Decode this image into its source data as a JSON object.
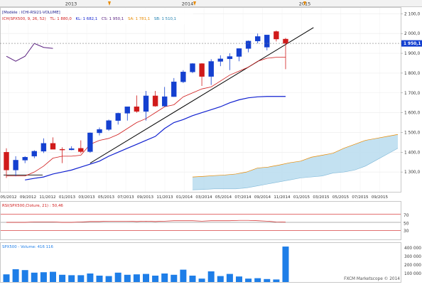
{
  "top_years": [
    "2013",
    "2014",
    "2015"
  ],
  "header": {
    "model_line": "[Modèle : ICHI-RSI21-VOLUME]",
    "ichimoku_line": "ICH(SPX500, 9, 26, 52) · TL: 1 880,0 · KL: 1 682,1 · CS: 1 950,1 · SA: 1 781,1 · SB: 1 510,1",
    "tl": "TL: 1 880,0",
    "kl": "KL: 1 682,1",
    "cs": "CS: 1 950,1",
    "sa": "SA: 1 781,1",
    "sb": "SB: 1 510,1",
    "ich_prefix": "ICH(SPX500, 9, 26, 52)"
  },
  "price_axis": {
    "ticks": [
      "2 100,0",
      "2 000,0",
      "1 900,0",
      "1 800,0",
      "1 700,0",
      "1 600,0",
      "1 500,0",
      "1 400,0",
      "1 300,0"
    ],
    "current_price": "1 950,1"
  },
  "time_axis": {
    "labels": [
      "05/2012",
      "09/2012",
      "11/2012",
      "01/2013",
      "03/2013",
      "05/2013",
      "07/2013",
      "09/2013",
      "11/2013",
      "01/2014",
      "03/2014",
      "05/2014",
      "07/2014",
      "09/2014",
      "11/2014",
      "01/2015",
      "03/2015",
      "05/2015",
      "07/2015",
      "09/2015"
    ]
  },
  "rsi_panel": {
    "label": "RSI(SPX500,Cloture, 21) : 50,46",
    "levels": [
      "70",
      "50",
      "30"
    ]
  },
  "volume_panel": {
    "label": "SPX500 - Volume: 416 116",
    "ticks": [
      "400 000",
      "300 000",
      "200 000",
      "100 000"
    ]
  },
  "copyright": "FXCM Marketscope © 2014",
  "colors": {
    "bull": "#1440d0",
    "bear": "#d01a1a",
    "tenkan": "#d01a1a",
    "kijun": "#1020d0",
    "chikou": "#5a2080",
    "cloud": "#b8dcef",
    "trendline": "#000000",
    "volume": "#1e7ee8",
    "orange": "#e88a00"
  },
  "chart_data": [
    {
      "type": "candlestick",
      "title": "",
      "candles": [
        {
          "o": 1400,
          "h": 1420,
          "l": 1270,
          "c": 1310
        },
        {
          "o": 1310,
          "h": 1380,
          "l": 1280,
          "c": 1360
        },
        {
          "o": 1360,
          "h": 1380,
          "l": 1345,
          "c": 1375
        },
        {
          "o": 1380,
          "h": 1410,
          "l": 1370,
          "c": 1405
        },
        {
          "o": 1405,
          "h": 1470,
          "l": 1396,
          "c": 1445
        },
        {
          "o": 1445,
          "h": 1475,
          "l": 1425,
          "c": 1415
        },
        {
          "o": 1415,
          "h": 1425,
          "l": 1345,
          "c": 1412
        },
        {
          "o": 1412,
          "h": 1430,
          "l": 1410,
          "c": 1418
        },
        {
          "o": 1420,
          "h": 1460,
          "l": 1395,
          "c": 1403
        },
        {
          "o": 1403,
          "h": 1500,
          "l": 1397,
          "c": 1498
        },
        {
          "o": 1498,
          "h": 1525,
          "l": 1485,
          "c": 1515
        },
        {
          "o": 1515,
          "h": 1565,
          "l": 1508,
          "c": 1560
        },
        {
          "o": 1560,
          "h": 1600,
          "l": 1540,
          "c": 1597
        },
        {
          "o": 1597,
          "h": 1630,
          "l": 1560,
          "c": 1630
        },
        {
          "o": 1630,
          "h": 1687,
          "l": 1600,
          "c": 1606
        },
        {
          "o": 1606,
          "h": 1710,
          "l": 1560,
          "c": 1685
        },
        {
          "o": 1685,
          "h": 1710,
          "l": 1630,
          "c": 1633
        },
        {
          "o": 1633,
          "h": 1730,
          "l": 1630,
          "c": 1681
        },
        {
          "o": 1681,
          "h": 1775,
          "l": 1680,
          "c": 1756
        },
        {
          "o": 1756,
          "h": 1815,
          "l": 1750,
          "c": 1806
        },
        {
          "o": 1806,
          "h": 1850,
          "l": 1800,
          "c": 1848
        },
        {
          "o": 1848,
          "h": 1850,
          "l": 1735,
          "c": 1783
        },
        {
          "o": 1783,
          "h": 1870,
          "l": 1740,
          "c": 1859
        },
        {
          "o": 1859,
          "h": 1890,
          "l": 1835,
          "c": 1872
        },
        {
          "o": 1872,
          "h": 1900,
          "l": 1815,
          "c": 1884
        },
        {
          "o": 1884,
          "h": 1925,
          "l": 1860,
          "c": 1924
        },
        {
          "o": 1924,
          "h": 1965,
          "l": 1905,
          "c": 1962
        },
        {
          "o": 1962,
          "h": 2000,
          "l": 1950,
          "c": 1985
        },
        {
          "o": 1931,
          "h": 1991,
          "l": 1915,
          "c": 1993
        },
        {
          "o": 2010,
          "h": 2015,
          "l": 1960,
          "c": 1972
        },
        {
          "o": 1972,
          "h": 1978,
          "l": 1820,
          "c": 1950
        }
      ],
      "tenkan": [
        1280,
        1280,
        1280,
        1300,
        1330,
        1370,
        1380,
        1380,
        1385,
        1440,
        1460,
        1470,
        1490,
        1520,
        1550,
        1570,
        1600,
        1630,
        1640,
        1680,
        1700,
        1720,
        1730,
        1760,
        1790,
        1810,
        1830,
        1860,
        1875,
        1880,
        1880
      ],
      "kijun_start_index": 2,
      "kijun": [
        1260,
        1268,
        1275,
        1290,
        1300,
        1310,
        1325,
        1340,
        1355,
        1380,
        1400,
        1420,
        1440,
        1460,
        1480,
        1520,
        1550,
        1565,
        1585,
        1600,
        1615,
        1630,
        1650,
        1665,
        1675,
        1680,
        1682,
        1682,
        1682
      ],
      "chikou": [
        1885,
        1860,
        1885,
        1950,
        1930,
        1925
      ],
      "cloud_upper": [
        1275,
        1278,
        1282,
        1285,
        1290,
        1300,
        1320,
        1325,
        1335,
        1347,
        1355,
        1375,
        1385,
        1395,
        1420,
        1440,
        1460,
        1470,
        1480,
        1490
      ],
      "cloud_lower": [
        1210,
        1212,
        1215,
        1215,
        1215,
        1220,
        1230,
        1240,
        1250,
        1260,
        1270,
        1275,
        1280,
        1295,
        1300,
        1310,
        1330,
        1360,
        1390,
        1420
      ],
      "trendline": {
        "from": {
          "i": 9,
          "price": 1345
        },
        "to": {
          "i": 33,
          "price": 2030
        }
      },
      "horizontal_level": 1285,
      "ylim": [
        1200,
        2130
      ]
    },
    {
      "type": "line",
      "title": "",
      "name": "RSI(SPX500,Cloture, 21)",
      "values": [
        50,
        50,
        50,
        51,
        51,
        51,
        50,
        50,
        51,
        52,
        52,
        53,
        53,
        53,
        52,
        53,
        52,
        53,
        54,
        54,
        54,
        53,
        54,
        54,
        54,
        55,
        55,
        54,
        53,
        51,
        50.46
      ],
      "ylim": [
        0,
        100
      ]
    },
    {
      "type": "bar",
      "title": "",
      "name": "SPX500 - Volume",
      "values": [
        90000,
        150000,
        140000,
        110000,
        115000,
        120000,
        85000,
        80000,
        80000,
        100000,
        75000,
        70000,
        110000,
        85000,
        90000,
        95000,
        75000,
        100000,
        85000,
        145000,
        75000,
        40000,
        125000,
        70000,
        95000,
        65000,
        40000,
        45000,
        35000,
        30000,
        416116
      ],
      "ylim": [
        0,
        450000
      ]
    }
  ]
}
